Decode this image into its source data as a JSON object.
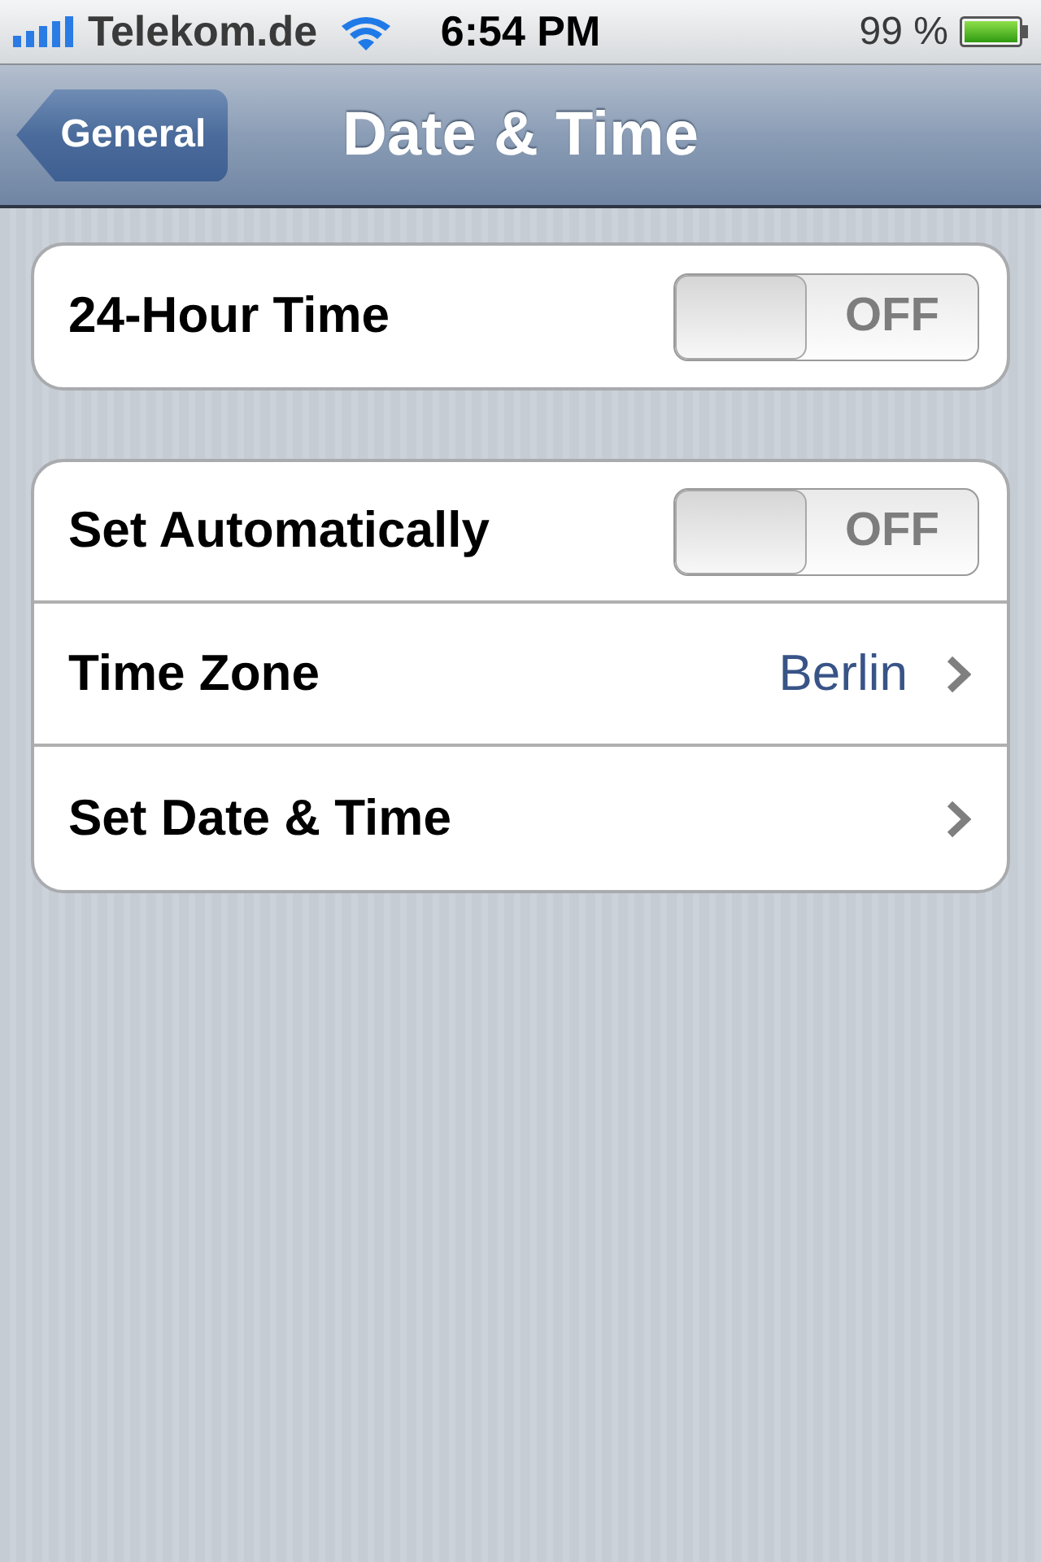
{
  "status_bar": {
    "carrier": "Telekom.de",
    "time": "6:54 PM",
    "battery": "99 %"
  },
  "nav_bar": {
    "back_button": "General",
    "title": "Date & Time"
  },
  "groups": [
    {
      "rows": [
        {
          "kind": "toggle",
          "label": "24-Hour Time",
          "on": false,
          "switch_text": "OFF"
        }
      ]
    },
    {
      "rows": [
        {
          "kind": "toggle",
          "label": "Set Automatically",
          "on": false,
          "switch_text": "OFF"
        },
        {
          "kind": "disclosure",
          "label": "Time Zone",
          "value": "Berlin"
        },
        {
          "kind": "disclosure",
          "label": "Set Date & Time"
        }
      ]
    }
  ]
}
